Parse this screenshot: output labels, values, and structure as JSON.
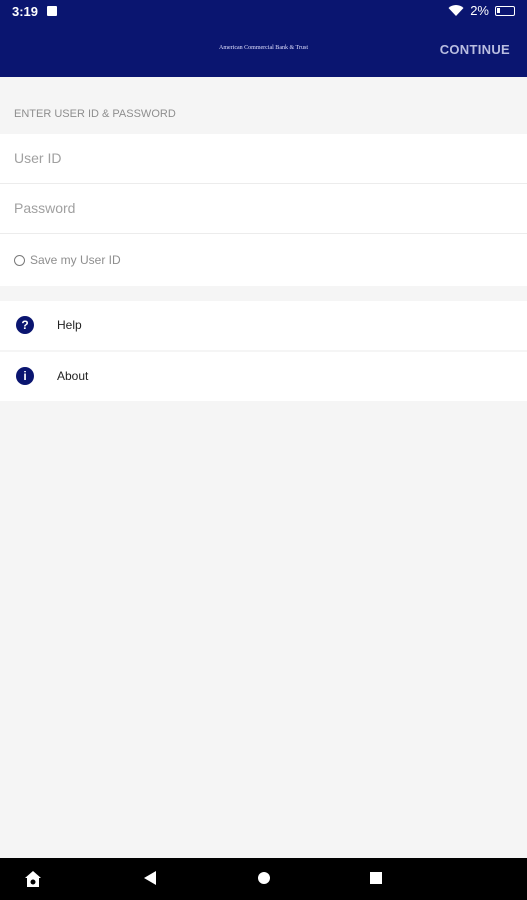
{
  "status_bar": {
    "time": "3:19",
    "battery_percent": "2%",
    "icons": [
      "notification-icon",
      "wifi-icon",
      "battery-icon"
    ]
  },
  "app_bar": {
    "logo_text": "American Commercial Bank & Trust",
    "continue_label": "CONTINUE"
  },
  "login": {
    "section_header": "ENTER USER ID & PASSWORD",
    "user_id_placeholder": "User ID",
    "user_id_value": "",
    "password_placeholder": "Password",
    "password_value": "",
    "save_user_id_label": "Save my User ID",
    "save_user_id_checked": false
  },
  "menu": {
    "items": [
      {
        "label": "Help",
        "icon": "help-icon",
        "glyph": "?"
      },
      {
        "label": "About",
        "icon": "info-icon",
        "glyph": "i"
      }
    ]
  },
  "nav_bar": {
    "icons": [
      "home-icon",
      "back-icon",
      "home-circle-icon",
      "recents-icon"
    ]
  },
  "colors": {
    "brand": "#0a1570",
    "background": "#f5f5f5"
  }
}
